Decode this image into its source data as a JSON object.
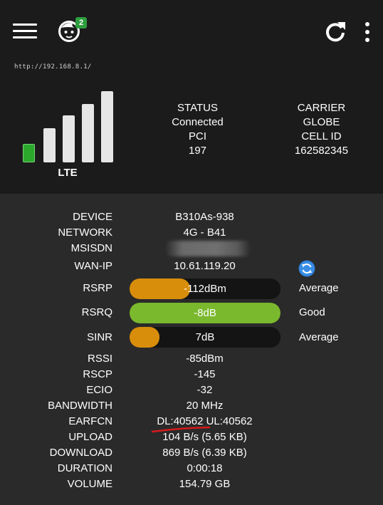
{
  "url": "http://192.168.8.1/",
  "notification_count": "2",
  "signal": {
    "technology": "LTE",
    "bars_total": 5,
    "bars_active": 1
  },
  "status": {
    "status_label": "STATUS",
    "status_value": "Connected",
    "pci_label": "PCI",
    "pci_value": "197",
    "carrier_label": "CARRIER",
    "carrier_value": "GLOBE",
    "cellid_label": "CELL ID",
    "cellid_value": "162582345"
  },
  "details": {
    "device_label": "DEVICE",
    "device_value": "B310As-938",
    "network_label": "NETWORK",
    "network_value": "4G - B41",
    "msisdn_label": "MSISDN",
    "wanip_label": "WAN-IP",
    "wanip_value": "10.61.119.20",
    "rsrp_label": "RSRP",
    "rsrp_value": "-112dBm",
    "rsrp_quality": "Average",
    "rsrp_level": 0.4,
    "rsrq_label": "RSRQ",
    "rsrq_value": "-8dB",
    "rsrq_quality": "Good",
    "rsrq_level": 1.0,
    "sinr_label": "SINR",
    "sinr_value": "7dB",
    "sinr_quality": "Average",
    "sinr_level": 0.2,
    "rssi_label": "RSSI",
    "rssi_value": "-85dBm",
    "rscp_label": "RSCP",
    "rscp_value": "-145",
    "ecio_label": "ECIO",
    "ecio_value": "-32",
    "bandwidth_label": "BANDWIDTH",
    "bandwidth_value": "20 MHz",
    "earfcn_label": "EARFCN",
    "earfcn_value": "DL:40562 UL:40562",
    "upload_label": "UPLOAD",
    "upload_value": "104 B/s (5.65 KB)",
    "download_label": "DOWNLOAD",
    "download_value": "869 B/s (6.39 KB)",
    "duration_label": "DURATION",
    "duration_value": "0:00:18",
    "volume_label": "VOLUME",
    "volume_value": "154.79 GB"
  },
  "colors": {
    "average": "#d98e0b",
    "good": "#7ab82e",
    "bar_active": "#2ba82b",
    "accent": "#2f7ed8"
  }
}
